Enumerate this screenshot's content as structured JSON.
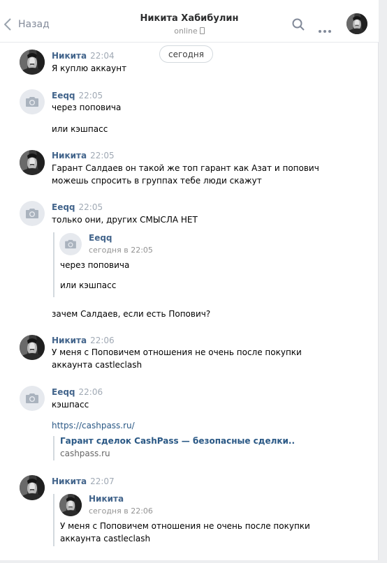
{
  "header": {
    "back_label": "Назад",
    "title": "Никита Хабибулин",
    "status": "online"
  },
  "date_divider": "сегодня",
  "messages": [
    {
      "sender": "Никита",
      "time": "22:04",
      "lines": [
        "Я куплю аккаунт"
      ]
    },
    {
      "sender": "Eeqq",
      "time": "22:05",
      "lines": [
        "через поповича",
        "или кэшпасс"
      ]
    },
    {
      "sender": "Никита",
      "time": "22:05",
      "lines": [
        "Гарант Салдаев он такой же топ гарант как Азат и попович",
        "можешь спросить в группах тебе люди скажут"
      ]
    },
    {
      "sender": "Eeqq",
      "time": "22:05",
      "lines": [
        "только они, других СМЫСЛА НЕТ",
        "зачем Салдаев, если есть Попович?"
      ],
      "forwarded": {
        "sender": "Eeqq",
        "time": "сегодня в 22:05",
        "lines": [
          "через поповича",
          "или кэшпасс"
        ]
      }
    },
    {
      "sender": "Никита",
      "time": "22:06",
      "lines": [
        "У меня с Поповичем отношения не очень после покупки",
        "аккаунта castleclash"
      ]
    },
    {
      "sender": "Eeqq",
      "time": "22:06",
      "lines": [
        "кэшпасс",
        "https://cashpass.ru/"
      ],
      "snippet": {
        "title": "Гарант сделок CashPass — безопасные сделки..",
        "domain": "cashpass.ru"
      }
    },
    {
      "sender": "Никита",
      "time": "22:07",
      "forwarded": {
        "sender": "Никита",
        "time": "сегодня в 22:06",
        "lines": [
          "У меня с Поповичем отношения не очень после покупки",
          "аккаунта castleclash"
        ]
      }
    }
  ]
}
